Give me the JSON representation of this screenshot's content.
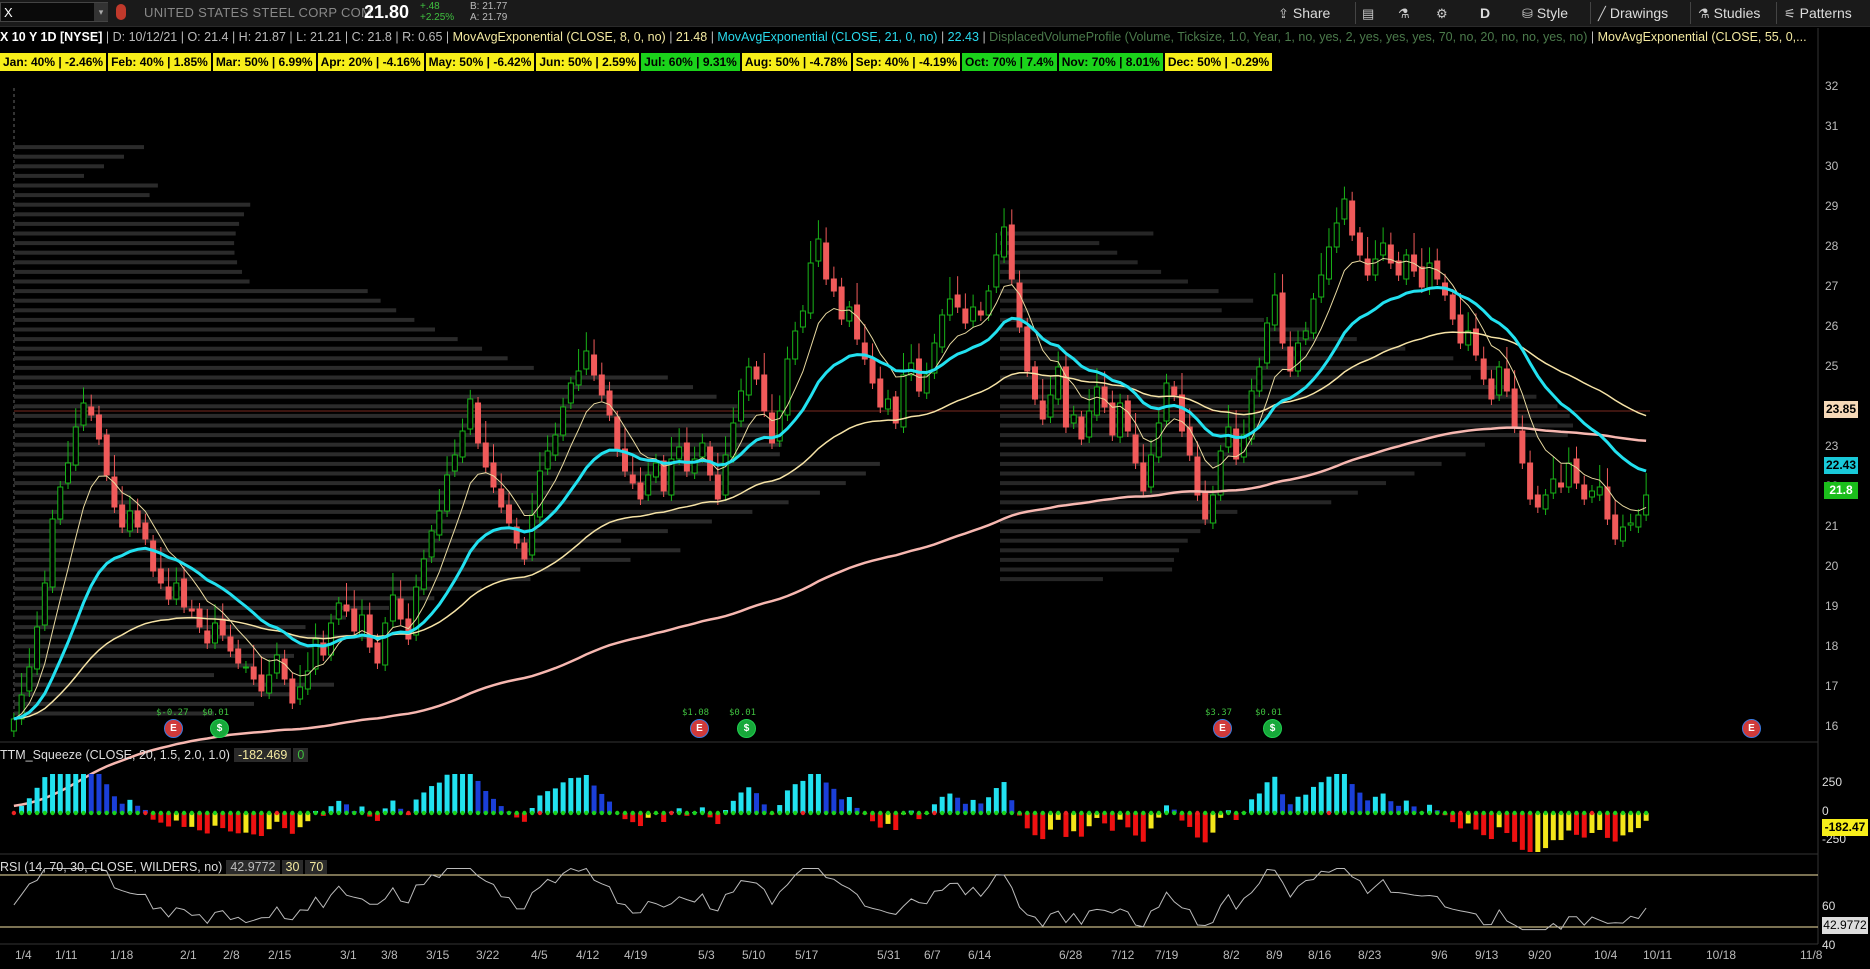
{
  "toolbar": {
    "symbol": "X",
    "company": "UNITED STATES STEEL CORP COM",
    "last": "21.80",
    "change": "+.48",
    "change_pct": "+2.25%",
    "bid": "B: 21.77",
    "ask": "A: 21.79",
    "share": "Share",
    "period": "D",
    "style": "Style",
    "drawings": "Drawings",
    "studies": "Studies",
    "patterns": "Patterns"
  },
  "info": {
    "title": "X 10 Y 1D [NYSE]",
    "date": "D: 10/12/21",
    "open": "O: 21.4",
    "high": "H: 21.87",
    "low": "L: 21.21",
    "close": "C: 21.8",
    "range": "R: 0.65",
    "ema8": "MovAvgExponential (CLOSE, 8, 0, no)",
    "ema8_val": "21.48",
    "ema21": "MovAvgExponential (CLOSE, 21, 0, no)",
    "ema21_val": "22.43",
    "dvp": "DisplacedVolumeProfile (Volume, Ticksize, 1.0, Year, 1, no, yes, 2, yes, yes, yes, 70, no, 20, no, no, yes, no)",
    "ema55": "MovAvgExponential (CLOSE, 55, 0,..."
  },
  "seasonal": [
    {
      "label": "Jan: 40% | -2.46%",
      "color": "yellow"
    },
    {
      "label": "Feb: 40% | 1.85%",
      "color": "yellow"
    },
    {
      "label": "Mar: 50% | 6.99%",
      "color": "yellow"
    },
    {
      "label": "Apr: 20% | -4.16%",
      "color": "yellow"
    },
    {
      "label": "May: 50% | -6.42%",
      "color": "yellow"
    },
    {
      "label": "Jun: 50% | 2.59%",
      "color": "yellow"
    },
    {
      "label": "Jul: 60% | 9.31%",
      "color": "green"
    },
    {
      "label": "Aug: 50% | -4.78%",
      "color": "yellow"
    },
    {
      "label": "Sep: 40% | -4.19%",
      "color": "yellow"
    },
    {
      "label": "Oct: 70% | 7.4%",
      "color": "green"
    },
    {
      "label": "Nov: 70% | 8.01%",
      "color": "green"
    },
    {
      "label": "Dec: 50% | -0.29%",
      "color": "yellow"
    }
  ],
  "price_axis": [
    "32",
    "31",
    "30",
    "29",
    "28",
    "27",
    "26",
    "25",
    "24",
    "23",
    "22",
    "21",
    "20",
    "19",
    "18",
    "17",
    "16"
  ],
  "price_tags": {
    "ema55": "23.85",
    "ema21": "22.43",
    "last": "21.8"
  },
  "ttm": {
    "label": "TTM_Squeeze (CLOSE, 20, 1.5, 2.0, 1.0)",
    "value": "-182.469",
    "zero": "0",
    "axis": [
      "250",
      "0",
      "-250"
    ],
    "tag": "-182.47"
  },
  "rsi": {
    "label": "RSI (14, 70, 30, CLOSE, WILDERS, no)",
    "value": "42.9772",
    "os": "30",
    "ob": "70",
    "axis": [
      "60",
      "40"
    ],
    "tag": "42.9772"
  },
  "dates": [
    "1/4",
    "1/11",
    "1/18",
    "2/1",
    "2/8",
    "2/15",
    "3/1",
    "3/8",
    "3/15",
    "3/22",
    "4/5",
    "4/12",
    "4/19",
    "5/3",
    "5/10",
    "5/17",
    "5/31",
    "6/7",
    "6/14",
    "6/28",
    "7/12",
    "7/19",
    "8/2",
    "8/9",
    "8/16",
    "8/23",
    "9/6",
    "9/13",
    "9/20",
    "10/4",
    "10/11",
    "10/18",
    "11/8"
  ],
  "events": [
    {
      "text": "$-0.27"
    },
    {
      "text": "$0.01"
    },
    {
      "text": "$1.08"
    },
    {
      "text": "$0.01"
    },
    {
      "text": "$3.37"
    },
    {
      "text": "$0.01"
    }
  ],
  "chart_data": {
    "type": "candlestick",
    "ylim": [
      15.5,
      32.5
    ],
    "closes": [
      16.2,
      16.8,
      17.5,
      18.5,
      19.6,
      21.2,
      22.0,
      22.6,
      23.5,
      24.1,
      23.8,
      23.2,
      22.3,
      21.5,
      21.0,
      21.4,
      21.0,
      20.7,
      19.9,
      19.6,
      19.2,
      19.6,
      19.0,
      18.9,
      18.5,
      18.1,
      18.6,
      18.3,
      17.9,
      17.6,
      17.5,
      17.2,
      16.9,
      17.3,
      17.8,
      17.2,
      16.6,
      17.0,
      17.4,
      18.2,
      17.8,
      18.6,
      19.1,
      18.9,
      18.4,
      18.8,
      18.0,
      17.6,
      18.6,
      19.3,
      18.7,
      18.2,
      19.5,
      20.2,
      20.9,
      21.4,
      22.3,
      22.8,
      23.4,
      24.2,
      23.1,
      22.5,
      22.0,
      21.5,
      21.1,
      20.6,
      20.2,
      21.3,
      22.4,
      22.9,
      23.3,
      24.0,
      24.6,
      24.9,
      25.4,
      24.8,
      24.3,
      23.8,
      22.9,
      22.4,
      22.1,
      21.7,
      22.3,
      22.6,
      21.9,
      22.7,
      23.0,
      22.4,
      22.7,
      23.1,
      22.3,
      21.7,
      22.8,
      23.6,
      24.4,
      25.0,
      24.7,
      23.9,
      23.1,
      23.9,
      25.2,
      25.9,
      26.4,
      27.6,
      28.2,
      27.2,
      26.9,
      26.2,
      26.5,
      25.7,
      25.2,
      24.6,
      24.0,
      24.2,
      23.6,
      24.8,
      25.1,
      24.4,
      24.8,
      25.6,
      26.3,
      26.7,
      26.5,
      26.1,
      26.5,
      26.3,
      26.9,
      27.8,
      28.5,
      27.2,
      26.0,
      24.9,
      24.2,
      23.7,
      24.3,
      25.0,
      23.5,
      23.8,
      23.2,
      23.9,
      24.5,
      24.0,
      23.3,
      24.1,
      23.4,
      22.6,
      21.9,
      22.8,
      23.6,
      24.6,
      24.3,
      23.4,
      22.8,
      21.8,
      21.2,
      21.8,
      22.9,
      23.5,
      22.7,
      23.3,
      24.4,
      25.0,
      26.1,
      26.8,
      25.6,
      24.9,
      25.6,
      25.9,
      26.7,
      27.3,
      28.0,
      28.6,
      29.2,
      28.3,
      27.8,
      27.3,
      27.7,
      28.1,
      27.6,
      27.3,
      27.8,
      27.4,
      27.0,
      27.6,
      27.2,
      26.8,
      26.2,
      25.6,
      25.9,
      25.3,
      24.7,
      24.2,
      25.0,
      24.4,
      23.5,
      22.6,
      21.7,
      21.5,
      21.8,
      22.2,
      22.0,
      22.6,
      22.1,
      21.7,
      21.9,
      22.0,
      21.2,
      20.7,
      21.0,
      21.1,
      21.3,
      21.8
    ],
    "ema8": [],
    "ema21": [],
    "ema55": []
  }
}
